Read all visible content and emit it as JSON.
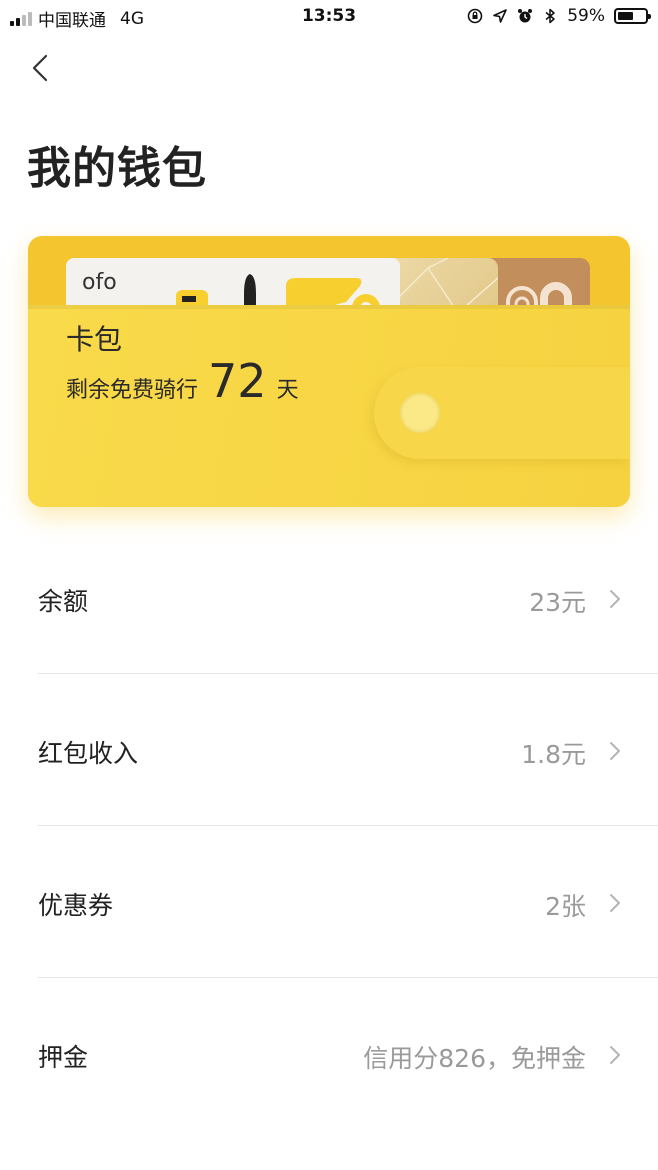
{
  "status_bar": {
    "carrier": "中国联通",
    "network": "4G",
    "time": "13:53",
    "battery": "59%",
    "battery_level": 0.59
  },
  "header": {
    "back_icon": "chevron-left-icon",
    "title": "我的钱包"
  },
  "wallet_card": {
    "brand": "ofo",
    "label": "卡包",
    "subtitle_prefix": "剩余免费骑行",
    "days": "72",
    "subtitle_suffix": "天",
    "colors": {
      "accent": "#f6d240",
      "back": "#f5c530"
    }
  },
  "list": {
    "items": [
      {
        "label": "余额",
        "value": "23元"
      },
      {
        "label": "红包收入",
        "value": "1.8元"
      },
      {
        "label": "优惠券",
        "value": "2张"
      },
      {
        "label": "押金",
        "value": "信用分826，免押金"
      }
    ]
  }
}
